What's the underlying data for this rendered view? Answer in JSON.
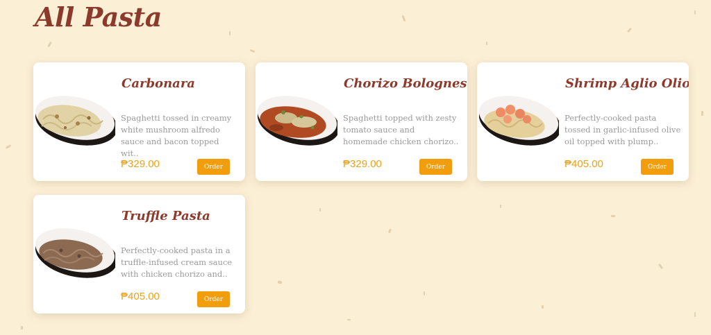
{
  "page": {
    "title": "All Pasta"
  },
  "colors": {
    "background": "#fbefd6",
    "title": "#8c3a2b",
    "accent": "#f29d0c",
    "price": "#e9a21a",
    "desc": "#9a9a9a"
  },
  "items": [
    {
      "name": "Carbonara",
      "description": "Spaghetti tossed in creamy white mushroom alfredo sauce and bacon topped wit..",
      "price": "₱329.00",
      "order_label": "Order",
      "image": "carbonara-plate"
    },
    {
      "name": "Chorizo Bolognese",
      "description": "Spaghetti topped with zesty tomato sauce and homemade chicken chorizo..",
      "price": "₱329.00",
      "order_label": "Order",
      "image": "bolognese-plate"
    },
    {
      "name": "Shrimp Aglio Olio",
      "description": "Perfectly-cooked pasta tossed in garlic-infused olive oil topped with plump..",
      "price": "₱405.00",
      "order_label": "Order",
      "image": "aglio-olio-plate"
    },
    {
      "name": "Truffle Pasta",
      "description": "Perfectly-cooked pasta in a truffle-infused cream sauce with chicken chorizo and..",
      "price": "₱405.00",
      "order_label": "Order",
      "image": "truffle-plate"
    }
  ]
}
